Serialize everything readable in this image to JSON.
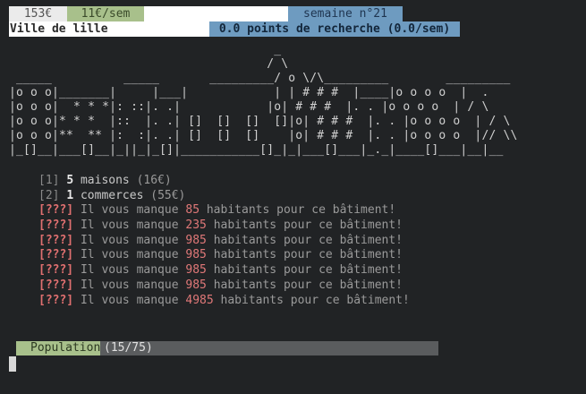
{
  "status": {
    "money": "153€",
    "income": "11€/sem",
    "week": "semaine n°21"
  },
  "city": {
    "name": "Ville de lille",
    "research": "0.0 points de recherche (0.0/sem)"
  },
  "ascii_art": "                                     _\n                                    / \\\n _____          _____       _________/ o \\/\\_________        _________\n|o o o|_______|     |___|            | | # # #  |____|o o o o  |  .\n|o o o|  * * *|: ::|. .|            |o| # # #  |. . |o o o o  | / \\\n|o o o|* * *  |::  |. .| []  []  []  []|o| # # #  |. . |o o o o  | / \\\n|o o o|**  ** |:  :|. .| []  []  []    |o| # # #  |. . |o o o o  |// \\\\\n|_[]__|___[]__|_||_|_[]|___________[]_|_|___[]___|_._|____[]___|__|__",
  "buildings": [
    {
      "index": "[1]",
      "count": "5",
      "name": "maisons",
      "price": "(16€)"
    },
    {
      "index": "[2]",
      "count": "1",
      "name": "commerces",
      "price": "(55€)"
    }
  ],
  "locked": [
    {
      "tag": "[???]",
      "before": "Il vous manque",
      "amount": "85",
      "after": "habitants pour ce bâtiment!"
    },
    {
      "tag": "[???]",
      "before": "Il vous manque",
      "amount": "235",
      "after": "habitants pour ce bâtiment!"
    },
    {
      "tag": "[???]",
      "before": "Il vous manque",
      "amount": "985",
      "after": "habitants pour ce bâtiment!"
    },
    {
      "tag": "[???]",
      "before": "Il vous manque",
      "amount": "985",
      "after": "habitants pour ce bâtiment!"
    },
    {
      "tag": "[???]",
      "before": "Il vous manque",
      "amount": "985",
      "after": "habitants pour ce bâtiment!"
    },
    {
      "tag": "[???]",
      "before": "Il vous manque",
      "amount": "985",
      "after": "habitants pour ce bâtiment!"
    },
    {
      "tag": "[???]",
      "before": "Il vous manque",
      "amount": "4985",
      "after": "habitants pour ce bâtiment!"
    }
  ],
  "population": {
    "label": "Population",
    "count": "(15/75)",
    "fill_fraction": 0.2
  },
  "colors": {
    "background": "#212325",
    "accent_green": "#a8c08b",
    "accent_blue": "#6e9bc0",
    "warning_red": "#e07070"
  }
}
